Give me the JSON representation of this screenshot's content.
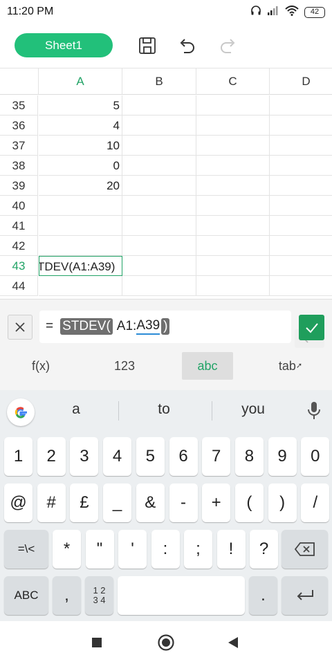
{
  "status_bar": {
    "time": "11:20 PM",
    "battery": "42"
  },
  "toolbar": {
    "sheet_label": "Sheet1"
  },
  "grid": {
    "columns": [
      "A",
      "B",
      "C",
      "D"
    ],
    "rows": [
      {
        "num": "35",
        "a": "5"
      },
      {
        "num": "36",
        "a": "4"
      },
      {
        "num": "37",
        "a": "10"
      },
      {
        "num": "38",
        "a": "0"
      },
      {
        "num": "39",
        "a": "20"
      },
      {
        "num": "40",
        "a": ""
      },
      {
        "num": "41",
        "a": ""
      },
      {
        "num": "42",
        "a": ""
      },
      {
        "num": "43",
        "a": "TDEV(A1:A39)"
      },
      {
        "num": "44",
        "a": ""
      }
    ]
  },
  "formula": {
    "equals": "=",
    "function_token": "STDEV(",
    "range_a": "A1:",
    "range_b": "A39",
    "close_token": ")"
  },
  "input_tabs": {
    "fx": "f(x)",
    "num": "123",
    "abc": "abc",
    "tab": "tab"
  },
  "keyboard": {
    "suggestions": [
      "a",
      "to",
      "you"
    ],
    "row1": [
      "1",
      "2",
      "3",
      "4",
      "5",
      "6",
      "7",
      "8",
      "9",
      "0"
    ],
    "row2": [
      "@",
      "#",
      "£",
      "_",
      "&",
      "-",
      "+",
      "(",
      ")",
      "/"
    ],
    "row3": [
      "=\\<",
      "*",
      "\"",
      "'",
      ":",
      ";",
      "!",
      "?"
    ],
    "abc_key": "ABC",
    "comma": ",",
    "numpad_top": "1 2",
    "numpad_bottom": "3 4",
    "period": "."
  },
  "colors": {
    "accent": "#21a366",
    "sheet_button": "#22c07a",
    "confirm": "#1f9e5c"
  }
}
